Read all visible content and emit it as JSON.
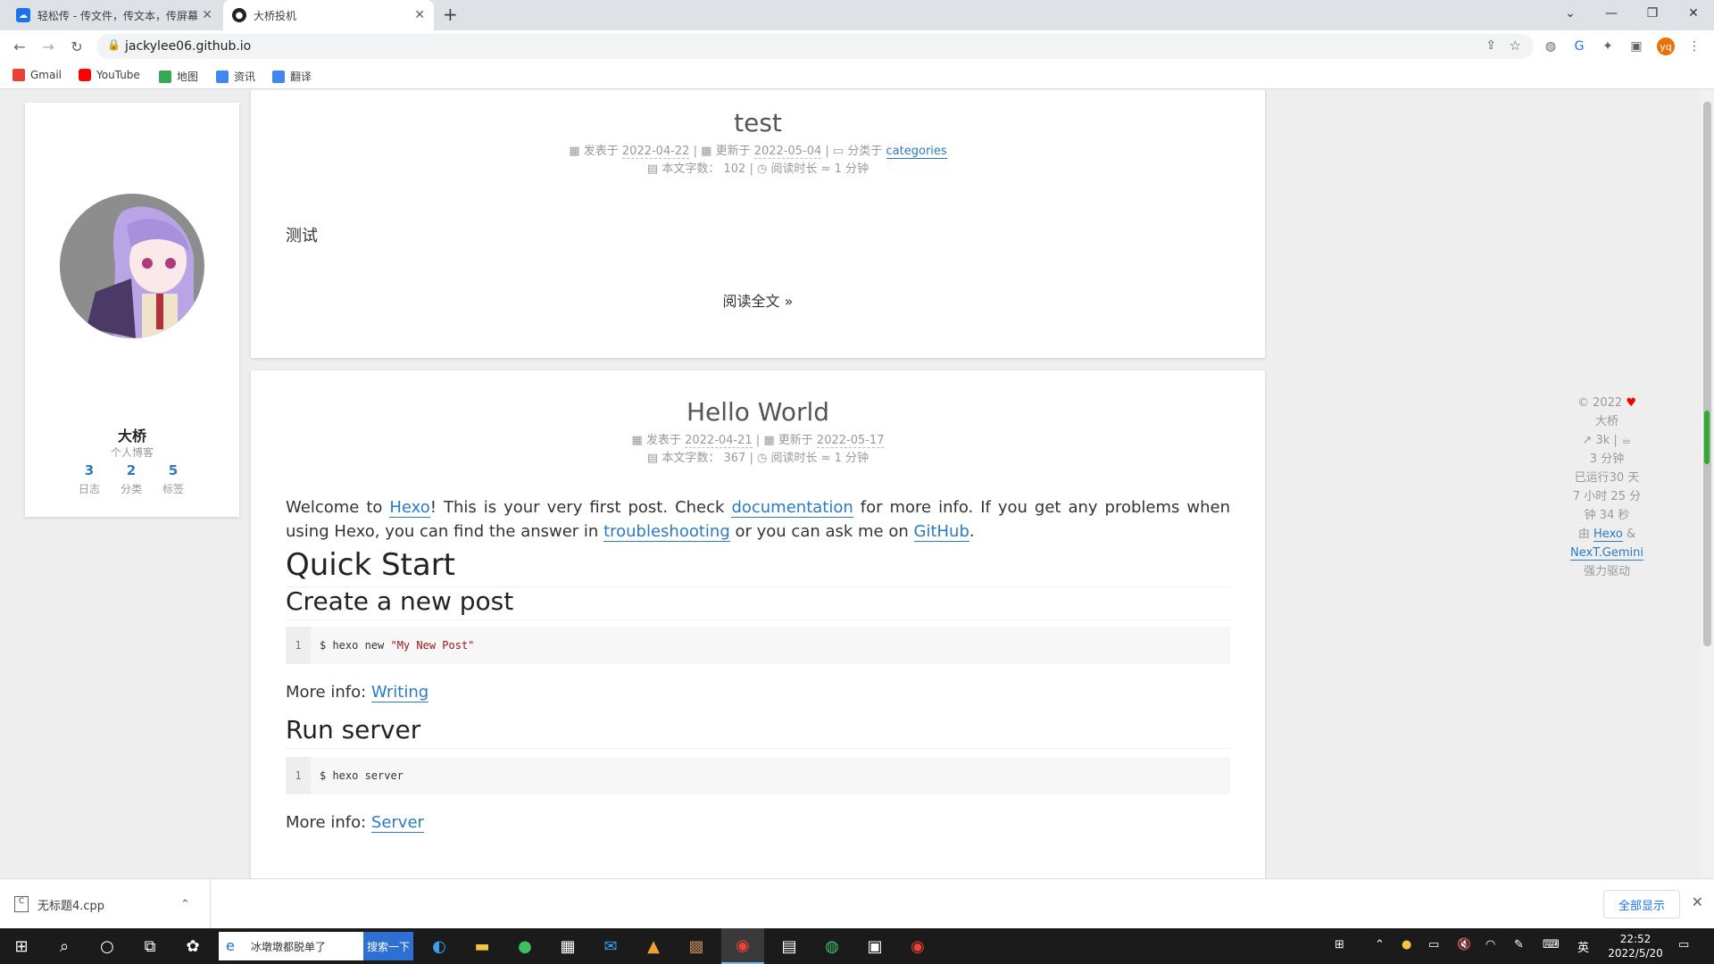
{
  "browser": {
    "tabs": [
      {
        "title": "轻松传 - 传文件，传文本，传屏幕",
        "favicon": "cloud-icon",
        "color": "#1a73e8"
      },
      {
        "title": "大桥投机",
        "favicon": "github-icon",
        "color": "#222222"
      }
    ],
    "url": "jackylee06.github.io",
    "bookmarks": [
      {
        "label": "Gmail",
        "icon": "gmail-icon",
        "color": "#ea4335"
      },
      {
        "label": "YouTube",
        "icon": "youtube-icon",
        "color": "#ff0000"
      },
      {
        "label": "地图",
        "icon": "maps-icon",
        "color": "#34a853"
      },
      {
        "label": "资讯",
        "icon": "news-icon",
        "color": "#4285f4"
      },
      {
        "label": "翻译",
        "icon": "translate-icon",
        "color": "#4285f4"
      }
    ],
    "profile_initials": "yq"
  },
  "sidebar": {
    "author": "大桥",
    "description": "个人博客",
    "stats": [
      {
        "count": "3",
        "label": "日志"
      },
      {
        "count": "2",
        "label": "分类"
      },
      {
        "count": "5",
        "label": "标签"
      }
    ]
  },
  "posts": [
    {
      "title": "test",
      "meta1": {
        "posted_label": "发表于",
        "posted": "2022-04-22",
        "updated_label": "更新于",
        "updated": "2022-05-04",
        "category_label": "分类于",
        "category": "categories"
      },
      "meta2": {
        "words_label": "本文字数：",
        "words": "102",
        "read_label": "阅读时长 ≈",
        "read": "1 分钟"
      },
      "excerpt": "测试",
      "read_more": "阅读全文 »"
    },
    {
      "title": "Hello World",
      "meta1": {
        "posted_label": "发表于",
        "posted": "2022-04-21",
        "updated_label": "更新于",
        "updated": "2022-05-17"
      },
      "meta2": {
        "words_label": "本文字数：",
        "words": "367",
        "read_label": "阅读时长 ≈",
        "read": "1 分钟"
      },
      "intro": {
        "t1": "Welcome to ",
        "l1": "Hexo",
        "t2": "! This is your very first post. Check ",
        "l2": "documentation",
        "t3": " for more info. If you get any problems when using Hexo, you can find the answer in ",
        "l3": "troubleshooting",
        "t4": " or you can ask me on ",
        "l4": "GitHub",
        "t5": "."
      },
      "h_quick_start": "Quick Start",
      "h_create": "Create a new post",
      "code1": {
        "line": "1",
        "cmd": "$ hexo new ",
        "arg": "\"My New Post\""
      },
      "more1": {
        "label": "More info: ",
        "link": "Writing"
      },
      "h_run": "Run server",
      "code2": {
        "line": "1",
        "cmd": "$ hexo server"
      },
      "more2": {
        "label": "More info: ",
        "link": "Server"
      }
    }
  ],
  "footer": {
    "copyright": "© 2022",
    "author": "大桥",
    "site_words": "3k",
    "site_time": "3 分钟",
    "uptime": [
      "已运行30 天",
      "7 小时 25 分",
      "钟 34 秒"
    ],
    "powered_prefix": "由",
    "powered_hexo": "Hexo",
    "powered_amp": "&",
    "powered_theme": "NexT.Gemini",
    "powered_suffix": "强力驱动"
  },
  "downloads": {
    "file": "无标题4.cpp",
    "show_all": "全部显示"
  },
  "taskbar": {
    "search_text": "冰墩墩都脱单了",
    "search_button": "搜索一下",
    "ime": "英",
    "time": "22:52",
    "date": "2022/5/20"
  }
}
